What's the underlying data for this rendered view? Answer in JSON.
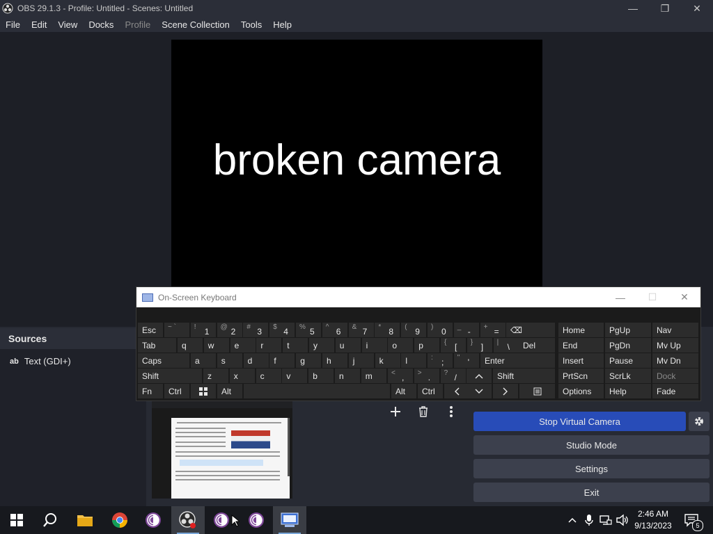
{
  "window": {
    "title": "OBS 29.1.3 - Profile: Untitled - Scenes: Untitled",
    "minimize": "—",
    "maximize": "❐",
    "close": "✕"
  },
  "menu": [
    "File",
    "Edit",
    "View",
    "Docks",
    "Profile",
    "Scene Collection",
    "Tools",
    "Help"
  ],
  "preview": {
    "text": "broken camera"
  },
  "sources": {
    "header": "Sources",
    "items": [
      {
        "type_glyph": "ab",
        "label": "Text (GDI+)"
      }
    ]
  },
  "controls": {
    "stop_virtual_camera": "Stop Virtual Camera",
    "studio_mode": "Studio Mode",
    "settings": "Settings",
    "exit": "Exit"
  },
  "osk": {
    "title": "On-Screen Keyboard",
    "keys": {
      "esc": "Esc",
      "tab": "Tab",
      "caps": "Caps",
      "shift": "Shift",
      "fn": "Fn",
      "ctrl": "Ctrl",
      "alt": "Alt",
      "del": "Del",
      "enter": "Enter",
      "backspace": "⌫",
      "home": "Home",
      "pgup": "PgUp",
      "nav": "Nav",
      "end": "End",
      "pgdn": "PgDn",
      "mvup": "Mv Up",
      "insert": "Insert",
      "pause": "Pause",
      "mvdn": "Mv Dn",
      "prtscn": "PrtScn",
      "scrlk": "ScrLk",
      "dock": "Dock",
      "options": "Options",
      "help": "Help",
      "fade": "Fade"
    },
    "number_row": [
      {
        "sup": "~ `",
        "main": ""
      },
      {
        "sup": "!",
        "main": "1"
      },
      {
        "sup": "@",
        "main": "2"
      },
      {
        "sup": "#",
        "main": "3"
      },
      {
        "sup": "$",
        "main": "4"
      },
      {
        "sup": "%",
        "main": "5"
      },
      {
        "sup": "^",
        "main": "6"
      },
      {
        "sup": "&",
        "main": "7"
      },
      {
        "sup": "*",
        "main": "8"
      },
      {
        "sup": "(",
        "main": "9"
      },
      {
        "sup": ")",
        "main": "0"
      },
      {
        "sup": "_",
        "main": "-"
      },
      {
        "sup": "+",
        "main": "="
      }
    ],
    "row_q": [
      "q",
      "w",
      "e",
      "r",
      "t",
      "y",
      "u",
      "i",
      "o",
      "p"
    ],
    "row_q_extra": [
      {
        "sup": "{",
        "main": "["
      },
      {
        "sup": "}",
        "main": "]"
      },
      {
        "sup": "|",
        "main": "\\"
      }
    ],
    "row_a": [
      "a",
      "s",
      "d",
      "f",
      "g",
      "h",
      "j",
      "k",
      "l"
    ],
    "row_a_extra": [
      {
        "sup": ":",
        "main": ";"
      },
      {
        "sup": "\"",
        "main": "'"
      }
    ],
    "row_z": [
      "z",
      "x",
      "c",
      "v",
      "b",
      "n",
      "m"
    ],
    "row_z_extra": [
      {
        "sup": "<",
        "main": ","
      },
      {
        "sup": ">",
        "main": "."
      },
      {
        "sup": "?",
        "main": "/"
      }
    ]
  },
  "taskbar": {
    "time": "2:46 AM",
    "date": "9/13/2023",
    "notifications": "5"
  }
}
